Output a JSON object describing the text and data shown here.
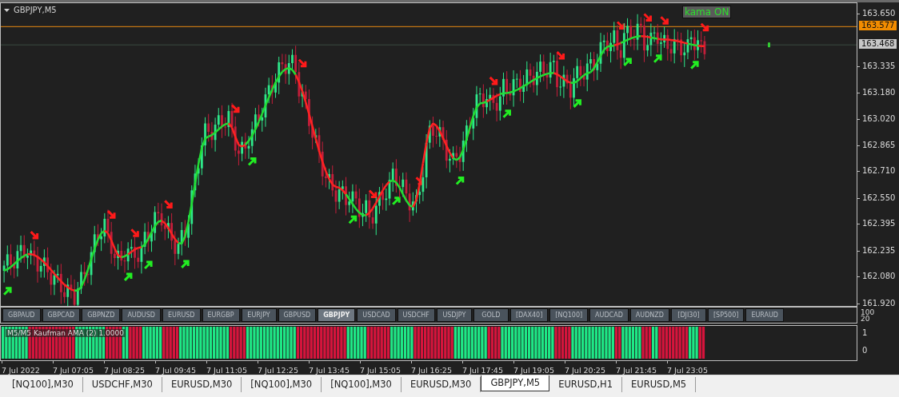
{
  "chart": {
    "title": "GBPJPY,M5",
    "badge": "kama ON",
    "price_axis": [
      "163.650",
      "163.335",
      "163.180",
      "163.020",
      "162.865",
      "162.710",
      "162.550",
      "162.395",
      "162.235",
      "162.080",
      "161.920"
    ],
    "bid_label": "163.577",
    "ask_label": "163.468"
  },
  "symbol_buttons": [
    {
      "label": "GBPAUD",
      "selected": false
    },
    {
      "label": "GBPCAD",
      "selected": false
    },
    {
      "label": "GBPNZD",
      "selected": false
    },
    {
      "label": "AUDUSD",
      "selected": false
    },
    {
      "label": "EURUSD",
      "selected": false
    },
    {
      "label": "EURGBP",
      "selected": false
    },
    {
      "label": "EURJPY",
      "selected": false
    },
    {
      "label": "GBPUSD",
      "selected": false
    },
    {
      "label": "GBPJPY",
      "selected": true
    },
    {
      "label": "USDCAD",
      "selected": false
    },
    {
      "label": "USDCHF",
      "selected": false
    },
    {
      "label": "USDJPY",
      "selected": false
    },
    {
      "label": "GOLD",
      "selected": false
    },
    {
      "label": "[DAX40]",
      "selected": false
    },
    {
      "label": "[NQ100]",
      "selected": false
    },
    {
      "label": "AUDCAD",
      "selected": false
    },
    {
      "label": "AUDNZD",
      "selected": false
    },
    {
      "label": "[DJI30]",
      "selected": false
    },
    {
      "label": "[SP500]",
      "selected": false
    },
    {
      "label": "EURAUD",
      "selected": false
    }
  ],
  "symbol_scale": [
    "100",
    "20"
  ],
  "indicator": {
    "label": "M5/M5 Kaufman AMA (2) 1.0000",
    "axis": [
      "1",
      "0"
    ],
    "bars_up": [
      true,
      true,
      true,
      true,
      true,
      true,
      true,
      true,
      false,
      false,
      false,
      false,
      false,
      false,
      false,
      false,
      false,
      false,
      false,
      false,
      false,
      false,
      true,
      true,
      true,
      true,
      true,
      true,
      true,
      true,
      true,
      false,
      false,
      false,
      false,
      false,
      true,
      true,
      false,
      false,
      false,
      false,
      true,
      true,
      true,
      true,
      true,
      true,
      false,
      false,
      false,
      false,
      false,
      true,
      true,
      true,
      true,
      true,
      true,
      true,
      true,
      true,
      true,
      true,
      true,
      true,
      true,
      true,
      false,
      false,
      false,
      false,
      false,
      true,
      true,
      true,
      true,
      true,
      true,
      true,
      true,
      true,
      true,
      true,
      true,
      true,
      true,
      true,
      false,
      false,
      false,
      false,
      false,
      false,
      false,
      false,
      false,
      false,
      false,
      false,
      false,
      false,
      false,
      true,
      true,
      true,
      true,
      true,
      true,
      false,
      false,
      false,
      false,
      false,
      false,
      false,
      true,
      true,
      true,
      true,
      true,
      true,
      true,
      false,
      false,
      false,
      false,
      false,
      false,
      false,
      false,
      false,
      false,
      false,
      false,
      true,
      true,
      true,
      true,
      true,
      true,
      true,
      true,
      true,
      true,
      false,
      false,
      false,
      false,
      true,
      true,
      true,
      true,
      true,
      true,
      true,
      true,
      true,
      true,
      true,
      true,
      true,
      true,
      true,
      true,
      false,
      false,
      false,
      false,
      false,
      true,
      true,
      true,
      true,
      true,
      true,
      true,
      true,
      true,
      true,
      true,
      true,
      true,
      false,
      false,
      true,
      true,
      true,
      true,
      true,
      true,
      false,
      false,
      false,
      true,
      true,
      false,
      false,
      false,
      false,
      false,
      false,
      false,
      false,
      false,
      true,
      true,
      true,
      false,
      false
    ]
  },
  "time_axis": [
    "7 Jul 2022",
    "7 Jul 07:05",
    "7 Jul 08:25",
    "7 Jul 09:45",
    "7 Jul 11:05",
    "7 Jul 12:25",
    "7 Jul 13:45",
    "7 Jul 15:05",
    "7 Jul 16:25",
    "7 Jul 17:45",
    "7 Jul 19:05",
    "7 Jul 20:25",
    "7 Jul 21:45",
    "7 Jul 23:05"
  ],
  "tabs": [
    {
      "label": "[NQ100],M30",
      "selected": false
    },
    {
      "label": "USDCHF,M30",
      "selected": false
    },
    {
      "label": "EURUSD,M30",
      "selected": false
    },
    {
      "label": "[NQ100],M30",
      "selected": false
    },
    {
      "label": "[NQ100],M30",
      "selected": false
    },
    {
      "label": "EURUSD,M30",
      "selected": false
    },
    {
      "label": "GBPJPY,M5",
      "selected": true
    },
    {
      "label": "EURUSD,H1",
      "selected": false
    },
    {
      "label": "EURUSD,M5",
      "selected": false
    }
  ]
}
